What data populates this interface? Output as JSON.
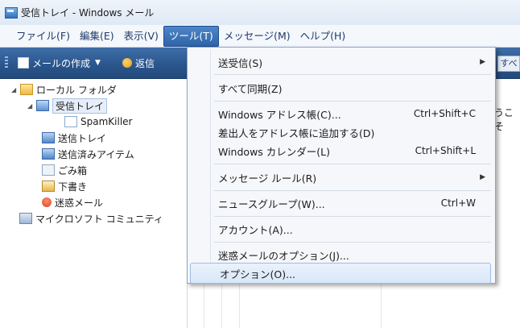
{
  "window": {
    "title": "受信トレイ - Windows メール"
  },
  "menubar": {
    "items": [
      "ファイル(F)",
      "編集(E)",
      "表示(V)",
      "ツール(T)",
      "メッセージ(M)",
      "ヘルプ(H)"
    ]
  },
  "toolbar": {
    "compose_label": "メールの作成",
    "reply_label": "返信",
    "right_label": "すべ"
  },
  "folders": {
    "local": "ローカル フォルダ",
    "inbox": "受信トレイ",
    "spamkiller": "SpamKiller",
    "outbox": "送信トレイ",
    "sent": "送信済みアイテム",
    "trash": "ごみ箱",
    "drafts": "下書き",
    "junk": "迷惑メール",
    "community": "マイクロソフト コミュニティ"
  },
  "listpane": {
    "peek_text": "うこそ"
  },
  "tools_menu": {
    "items": [
      {
        "label": "送受信(S)",
        "shortcut": "",
        "submenu": true
      },
      {
        "label": "すべて同期(Z)",
        "shortcut": "",
        "submenu": false
      },
      {
        "label": "Windows アドレス帳(C)...",
        "shortcut": "Ctrl+Shift+C",
        "submenu": false
      },
      {
        "label": "差出人をアドレス帳に追加する(D)",
        "shortcut": "",
        "submenu": false
      },
      {
        "label": "Windows カレンダー(L)",
        "shortcut": "Ctrl+Shift+L",
        "submenu": false
      },
      {
        "label": "メッセージ ルール(R)",
        "shortcut": "",
        "submenu": true
      },
      {
        "label": "ニュースグループ(W)...",
        "shortcut": "Ctrl+W",
        "submenu": false
      },
      {
        "label": "アカウント(A)...",
        "shortcut": "",
        "submenu": false
      },
      {
        "label": "迷惑メールのオプション(J)...",
        "shortcut": "",
        "submenu": false
      },
      {
        "label": "オプション(O)...",
        "shortcut": "",
        "submenu": false,
        "highlighted": true
      }
    ]
  },
  "icons": {
    "arrow_right": "▶",
    "tree_expanded": "◢",
    "dropdown": "▼"
  }
}
